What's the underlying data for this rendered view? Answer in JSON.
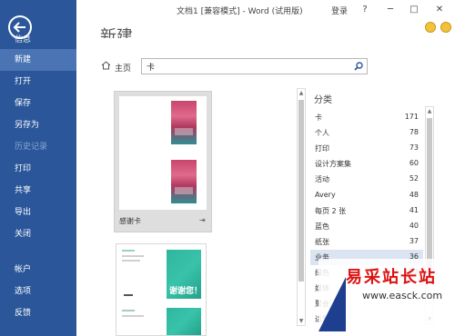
{
  "nav": {
    "info": "信息",
    "items": [
      {
        "label": "新建",
        "state": "active"
      },
      {
        "label": "打开",
        "state": "normal"
      },
      {
        "label": "保存",
        "state": "normal"
      },
      {
        "label": "另存为",
        "state": "normal"
      },
      {
        "label": "历史记录",
        "state": "disabled"
      },
      {
        "label": "打印",
        "state": "normal"
      },
      {
        "label": "共享",
        "state": "normal"
      },
      {
        "label": "导出",
        "state": "normal"
      },
      {
        "label": "关闭",
        "state": "normal"
      },
      {
        "label": "帐户",
        "state": "normal"
      },
      {
        "label": "选项",
        "state": "normal"
      },
      {
        "label": "反馈",
        "state": "normal"
      }
    ]
  },
  "titlebar": {
    "title": "文档1 [兼容模式] - Word (试用版)",
    "login": "登录",
    "help": "?",
    "minimize": "─",
    "restore": "□",
    "close": "✕"
  },
  "page": {
    "title": "新建"
  },
  "search": {
    "home_label": "主页",
    "value": "卡"
  },
  "templates": [
    {
      "name": "感谢卡"
    },
    {
      "name": "谢谢您！"
    }
  ],
  "categories": {
    "header": "分类",
    "items": [
      {
        "name": "卡",
        "count": "171"
      },
      {
        "name": "个人",
        "count": "78"
      },
      {
        "name": "打印",
        "count": "73"
      },
      {
        "name": "设计方案集",
        "count": "60"
      },
      {
        "name": "活动",
        "count": "52"
      },
      {
        "name": "Avery",
        "count": "48"
      },
      {
        "name": "每页 2 张",
        "count": "41"
      },
      {
        "name": "蓝色",
        "count": "40"
      },
      {
        "name": "纸张",
        "count": "37"
      },
      {
        "name": "业务",
        "count": "36"
      },
      {
        "name": "绿色",
        "count": "32"
      },
      {
        "name": "媒体",
        "count": ""
      },
      {
        "name": "聚会",
        "count": ""
      },
      {
        "name": "适题",
        "count": ""
      }
    ],
    "selected_index": 9
  },
  "watermark": {
    "title": "易采站长站",
    "url": "www.easck.com"
  },
  "colors": {
    "nav_bg": "#2b579a",
    "nav_active": "#4a74b3",
    "selected_row": "#dbe4f1"
  }
}
